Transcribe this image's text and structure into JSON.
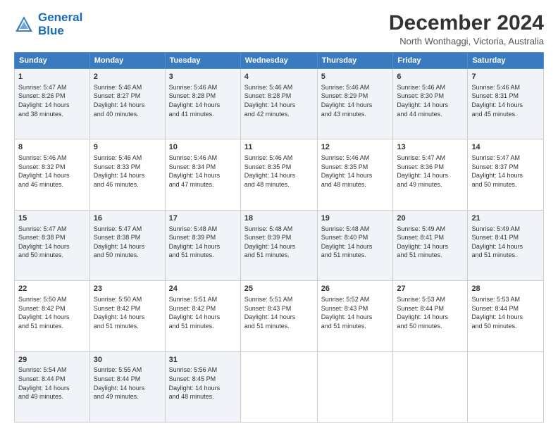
{
  "logo": {
    "line1": "General",
    "line2": "Blue"
  },
  "title": "December 2024",
  "subtitle": "North Wonthaggi, Victoria, Australia",
  "headers": [
    "Sunday",
    "Monday",
    "Tuesday",
    "Wednesday",
    "Thursday",
    "Friday",
    "Saturday"
  ],
  "weeks": [
    [
      {
        "day": "1",
        "info": "Sunrise: 5:47 AM\nSunset: 8:26 PM\nDaylight: 14 hours\nand 38 minutes."
      },
      {
        "day": "2",
        "info": "Sunrise: 5:46 AM\nSunset: 8:27 PM\nDaylight: 14 hours\nand 40 minutes."
      },
      {
        "day": "3",
        "info": "Sunrise: 5:46 AM\nSunset: 8:28 PM\nDaylight: 14 hours\nand 41 minutes."
      },
      {
        "day": "4",
        "info": "Sunrise: 5:46 AM\nSunset: 8:28 PM\nDaylight: 14 hours\nand 42 minutes."
      },
      {
        "day": "5",
        "info": "Sunrise: 5:46 AM\nSunset: 8:29 PM\nDaylight: 14 hours\nand 43 minutes."
      },
      {
        "day": "6",
        "info": "Sunrise: 5:46 AM\nSunset: 8:30 PM\nDaylight: 14 hours\nand 44 minutes."
      },
      {
        "day": "7",
        "info": "Sunrise: 5:46 AM\nSunset: 8:31 PM\nDaylight: 14 hours\nand 45 minutes."
      }
    ],
    [
      {
        "day": "8",
        "info": "Sunrise: 5:46 AM\nSunset: 8:32 PM\nDaylight: 14 hours\nand 46 minutes."
      },
      {
        "day": "9",
        "info": "Sunrise: 5:46 AM\nSunset: 8:33 PM\nDaylight: 14 hours\nand 46 minutes."
      },
      {
        "day": "10",
        "info": "Sunrise: 5:46 AM\nSunset: 8:34 PM\nDaylight: 14 hours\nand 47 minutes."
      },
      {
        "day": "11",
        "info": "Sunrise: 5:46 AM\nSunset: 8:35 PM\nDaylight: 14 hours\nand 48 minutes."
      },
      {
        "day": "12",
        "info": "Sunrise: 5:46 AM\nSunset: 8:35 PM\nDaylight: 14 hours\nand 48 minutes."
      },
      {
        "day": "13",
        "info": "Sunrise: 5:47 AM\nSunset: 8:36 PM\nDaylight: 14 hours\nand 49 minutes."
      },
      {
        "day": "14",
        "info": "Sunrise: 5:47 AM\nSunset: 8:37 PM\nDaylight: 14 hours\nand 50 minutes."
      }
    ],
    [
      {
        "day": "15",
        "info": "Sunrise: 5:47 AM\nSunset: 8:38 PM\nDaylight: 14 hours\nand 50 minutes."
      },
      {
        "day": "16",
        "info": "Sunrise: 5:47 AM\nSunset: 8:38 PM\nDaylight: 14 hours\nand 50 minutes."
      },
      {
        "day": "17",
        "info": "Sunrise: 5:48 AM\nSunset: 8:39 PM\nDaylight: 14 hours\nand 51 minutes."
      },
      {
        "day": "18",
        "info": "Sunrise: 5:48 AM\nSunset: 8:39 PM\nDaylight: 14 hours\nand 51 minutes."
      },
      {
        "day": "19",
        "info": "Sunrise: 5:48 AM\nSunset: 8:40 PM\nDaylight: 14 hours\nand 51 minutes."
      },
      {
        "day": "20",
        "info": "Sunrise: 5:49 AM\nSunset: 8:41 PM\nDaylight: 14 hours\nand 51 minutes."
      },
      {
        "day": "21",
        "info": "Sunrise: 5:49 AM\nSunset: 8:41 PM\nDaylight: 14 hours\nand 51 minutes."
      }
    ],
    [
      {
        "day": "22",
        "info": "Sunrise: 5:50 AM\nSunset: 8:42 PM\nDaylight: 14 hours\nand 51 minutes."
      },
      {
        "day": "23",
        "info": "Sunrise: 5:50 AM\nSunset: 8:42 PM\nDaylight: 14 hours\nand 51 minutes."
      },
      {
        "day": "24",
        "info": "Sunrise: 5:51 AM\nSunset: 8:42 PM\nDaylight: 14 hours\nand 51 minutes."
      },
      {
        "day": "25",
        "info": "Sunrise: 5:51 AM\nSunset: 8:43 PM\nDaylight: 14 hours\nand 51 minutes."
      },
      {
        "day": "26",
        "info": "Sunrise: 5:52 AM\nSunset: 8:43 PM\nDaylight: 14 hours\nand 51 minutes."
      },
      {
        "day": "27",
        "info": "Sunrise: 5:53 AM\nSunset: 8:44 PM\nDaylight: 14 hours\nand 50 minutes."
      },
      {
        "day": "28",
        "info": "Sunrise: 5:53 AM\nSunset: 8:44 PM\nDaylight: 14 hours\nand 50 minutes."
      }
    ],
    [
      {
        "day": "29",
        "info": "Sunrise: 5:54 AM\nSunset: 8:44 PM\nDaylight: 14 hours\nand 49 minutes."
      },
      {
        "day": "30",
        "info": "Sunrise: 5:55 AM\nSunset: 8:44 PM\nDaylight: 14 hours\nand 49 minutes."
      },
      {
        "day": "31",
        "info": "Sunrise: 5:56 AM\nSunset: 8:45 PM\nDaylight: 14 hours\nand 48 minutes."
      },
      null,
      null,
      null,
      null
    ]
  ]
}
